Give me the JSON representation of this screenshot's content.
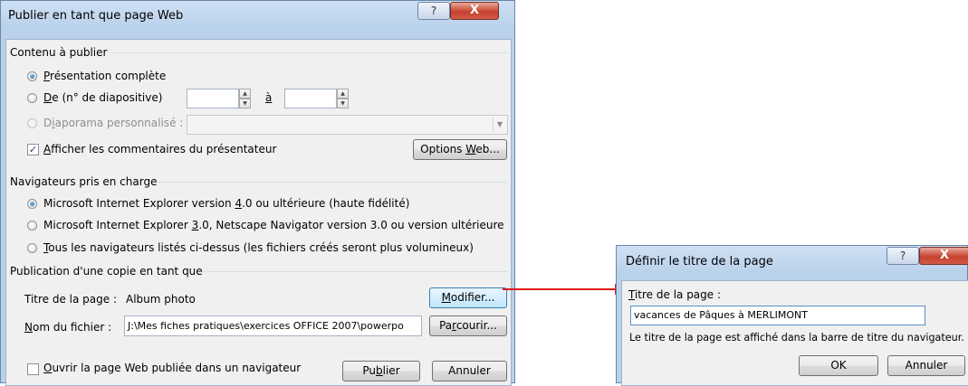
{
  "main_dialog": {
    "title": "Publier en tant que page Web",
    "help_glyph": "?",
    "close_glyph": "X",
    "content_group": {
      "label": "Contenu à publier",
      "radio_full": {
        "mnemonic": "P",
        "rest": "résentation complète",
        "checked": true
      },
      "radio_from": {
        "mnemonic": "D",
        "rest": "e (n° de diapositive)",
        "checked": false
      },
      "from_value": "",
      "to_label": "à",
      "to_value": "",
      "radio_custom": {
        "prefix": "D",
        "mnemonic": "i",
        "rest": "aporama personnalisé :",
        "disabled": true
      },
      "custom_select_value": "",
      "notes_checkbox": {
        "mnemonic": "A",
        "rest": "fficher les commentaires du présentateur",
        "checked": true
      },
      "options_button": {
        "prefix": "Options ",
        "mnemonic": "W",
        "rest": "eb..."
      }
    },
    "browsers_group": {
      "label": "Navigateurs pris en charge",
      "option_ie4": {
        "prefix": "Microsoft Internet Explorer version ",
        "mnemonic": "4",
        "rest": ".0 ou ultérieure (haute fidélité)",
        "checked": true
      },
      "option_ie3": {
        "prefix": "Microsoft Internet Explorer ",
        "mnemonic": "3",
        "rest": ".0, Netscape Navigator version 3.0 ou version ultérieure",
        "checked": false
      },
      "option_all": {
        "mnemonic": "T",
        "rest": "ous les navigateurs listés ci-dessus (les fichiers créés seront plus volumineux)",
        "checked": false
      }
    },
    "publish_group": {
      "label": "Publication d'une copie en tant que",
      "page_title_label": "Titre de la page :",
      "page_title_value": "Album photo",
      "modify_button": {
        "mnemonic": "M",
        "rest": "odifier..."
      },
      "file_name_label": {
        "mnemonic": "N",
        "rest": "om du fichier :"
      },
      "file_name_value": "J:\\Mes fiches pratiques\\exercices OFFICE 2007\\powerpo",
      "browse_button": {
        "prefix": "Pa",
        "mnemonic": "r",
        "rest": "courir..."
      }
    },
    "open_checkbox": {
      "mnemonic": "O",
      "rest": "uvrir la page Web publiée dans un navigateur",
      "checked": false
    },
    "publish_button": {
      "prefix": "Pu",
      "mnemonic": "b",
      "rest": "lier"
    },
    "cancel_button": "Annuler"
  },
  "title_dialog": {
    "title": "Définir le titre de la page",
    "help_glyph": "?",
    "close_glyph": "X",
    "field_label": {
      "mnemonic": "T",
      "rest": "itre de la page :"
    },
    "field_value": "vacances de Pâques à MERLIMONT",
    "info_text": "Le titre de la page est affiché dans la barre de titre du navigateur.",
    "ok_button": "OK",
    "cancel_button": "Annuler"
  },
  "colors": {
    "arrow": "#e0191b",
    "window_frame": "#b9d1ea",
    "close_button": "#c6422f"
  }
}
